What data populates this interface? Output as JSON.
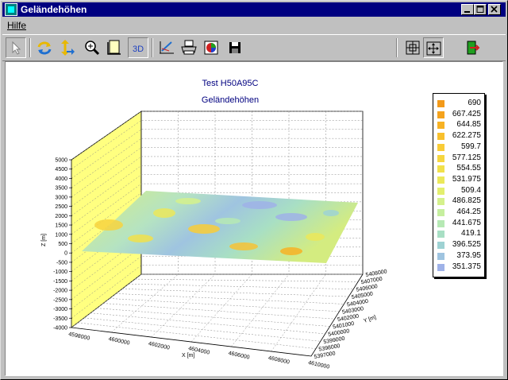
{
  "window": {
    "title": "Geländehöhen"
  },
  "menu": {
    "items": [
      "Hilfe"
    ]
  },
  "chart": {
    "title": "Test H50A95C",
    "subtitle": "Geländehöhen",
    "z_axis": {
      "label": "Z [m]",
      "ticks": [
        "5000",
        "4500",
        "4000",
        "3500",
        "3000",
        "2500",
        "2000",
        "1500",
        "1000",
        "500",
        "0",
        "-500",
        "-1000",
        "-1500",
        "-2000",
        "-2500",
        "-3000",
        "-3500",
        "-4000"
      ]
    },
    "x_axis": {
      "label": "X [m]",
      "ticks": [
        "4598000",
        "4600000",
        "4602000",
        "4604000",
        "4606000",
        "4608000",
        "4610000"
      ]
    },
    "y_axis": {
      "label": "Y [m]",
      "ticks": [
        "5397000",
        "5398000",
        "5399000",
        "5400000",
        "5401000",
        "5402000",
        "5403000",
        "5404000",
        "5405000",
        "5406000",
        "5407000",
        "5408000"
      ]
    }
  },
  "legend": {
    "values": [
      "690",
      "667.425",
      "644.85",
      "622.275",
      "599.7",
      "577.125",
      "554.55",
      "531.975",
      "509.4",
      "486.825",
      "464.25",
      "441.675",
      "419.1",
      "396.525",
      "373.95",
      "351.375"
    ],
    "colors": [
      "#f39a1a",
      "#f5a31d",
      "#f7b224",
      "#f8c02d",
      "#f9cc37",
      "#f6d63f",
      "#f1e04a",
      "#ebe85a",
      "#e3ef6e",
      "#d5f18c",
      "#c6ef9f",
      "#b6e9b4",
      "#a8dfc4",
      "#9ed2d3",
      "#9fc4e0",
      "#9fb2e8"
    ]
  },
  "chart_data": {
    "type": "surface",
    "title": "Test H50A95C",
    "subtitle": "Geländehöhen",
    "xlabel": "X [m]",
    "ylabel": "Y [m]",
    "zlabel": "Z [m]",
    "xlim": [
      4598000,
      4610000
    ],
    "ylim": [
      5397000,
      5408000
    ],
    "zlim": [
      -4000,
      5000
    ],
    "color_scale": [
      690,
      667.425,
      644.85,
      622.275,
      599.7,
      577.125,
      554.55,
      531.975,
      509.4,
      486.825,
      464.25,
      441.675,
      419.1,
      396.525,
      373.95,
      351.375
    ],
    "grid": true,
    "legend": "right"
  }
}
